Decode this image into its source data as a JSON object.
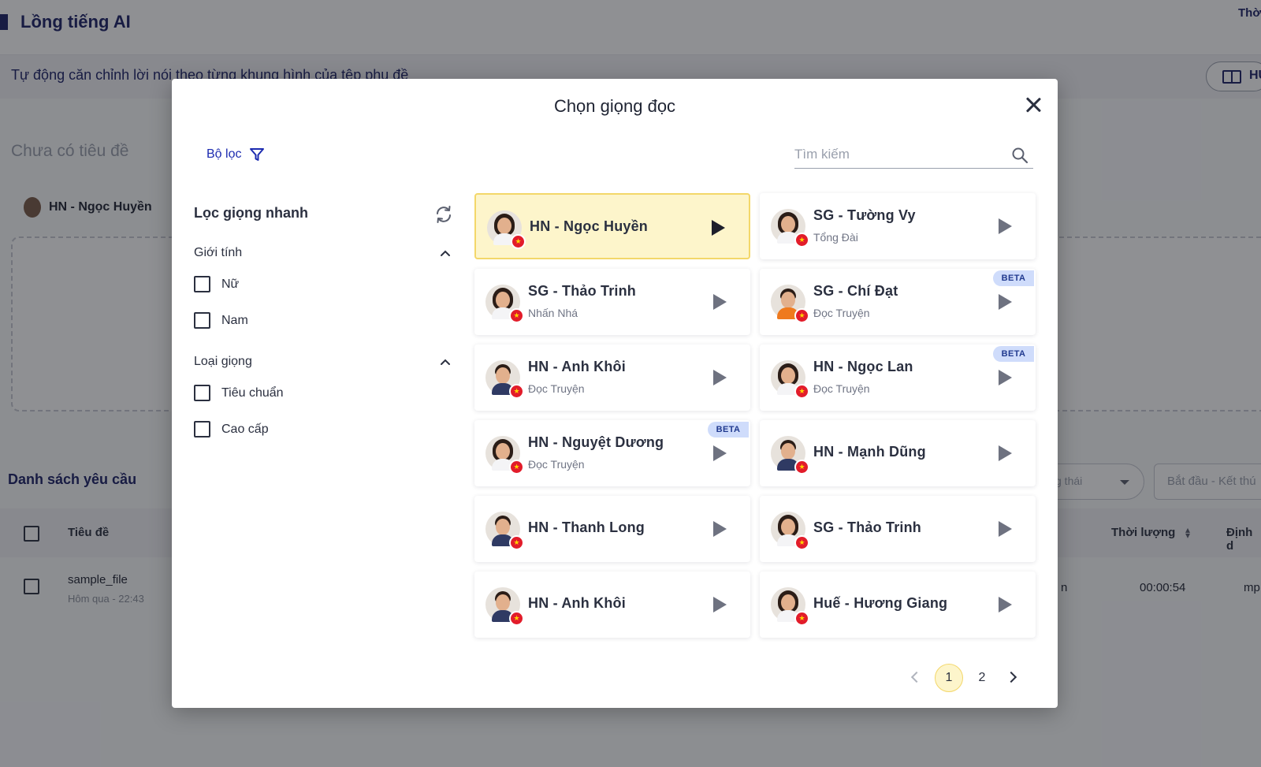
{
  "background": {
    "app_title": "Lồng tiếng AI",
    "top_right_text": "Thờ",
    "subtitle": "Tự động căn chỉnh lời nói theo từng khung hình của tệp phụ đề",
    "guide_button_label": "HU",
    "untitled_label": "Chưa có tiêu đề",
    "selected_voice": "HN - Ngọc Huyền",
    "requests_title": "Danh sách yêu cầu",
    "status_select_label": "g thái",
    "date_range_label": "Bắt đầu - Kết thú",
    "table": {
      "columns": [
        "Tiêu đề",
        "Thời lượng",
        "Định d"
      ],
      "rows": [
        {
          "name": "sample_file",
          "date": "Hôm qua - 22:43",
          "col_n": "n",
          "duration": "00:00:54",
          "format": "mp"
        }
      ]
    }
  },
  "modal": {
    "title": "Chọn giọng đọc",
    "filter_label": "Bộ lọc",
    "search_placeholder": "Tìm kiếm",
    "quick_filter_title": "Lọc giọng nhanh",
    "groups": [
      {
        "title": "Giới tính",
        "options": [
          "Nữ",
          "Nam"
        ]
      },
      {
        "title": "Loại giọng",
        "options": [
          "Tiêu chuẩn",
          "Cao cấp"
        ]
      }
    ],
    "voices": [
      {
        "name": "HN - Ngọc Huyền",
        "style": "",
        "beta": "",
        "selected": true,
        "avatar": "female"
      },
      {
        "name": "SG - Tường Vy",
        "style": "Tổng Đài",
        "beta": "",
        "selected": false,
        "avatar": "female"
      },
      {
        "name": "SG - Thảo Trinh",
        "style": "Nhấn Nhá",
        "beta": "",
        "selected": false,
        "avatar": "female"
      },
      {
        "name": "SG - Chí Đạt",
        "style": "Đọc Truyện",
        "beta": "BETA",
        "selected": false,
        "avatar": "orange"
      },
      {
        "name": "HN - Anh Khôi",
        "style": "Đọc Truyện",
        "beta": "",
        "selected": false,
        "avatar": "male"
      },
      {
        "name": "HN - Ngọc Lan",
        "style": "Đọc Truyện",
        "beta": "BETA",
        "selected": false,
        "avatar": "female"
      },
      {
        "name": "HN - Nguyệt Dương",
        "style": "Đọc Truyện",
        "beta": "BETA",
        "selected": false,
        "avatar": "female"
      },
      {
        "name": "HN - Mạnh Dũng",
        "style": "",
        "beta": "",
        "selected": false,
        "avatar": "male"
      },
      {
        "name": "HN - Thanh Long",
        "style": "",
        "beta": "",
        "selected": false,
        "avatar": "male"
      },
      {
        "name": "SG - Thảo Trinh",
        "style": "",
        "beta": "",
        "selected": false,
        "avatar": "female"
      },
      {
        "name": "HN - Anh Khôi",
        "style": "",
        "beta": "",
        "selected": false,
        "avatar": "male"
      },
      {
        "name": "Huế - Hương Giang",
        "style": "",
        "beta": "",
        "selected": false,
        "avatar": "female"
      }
    ],
    "pagination": {
      "pages": [
        "1",
        "2"
      ],
      "current": "1"
    }
  }
}
